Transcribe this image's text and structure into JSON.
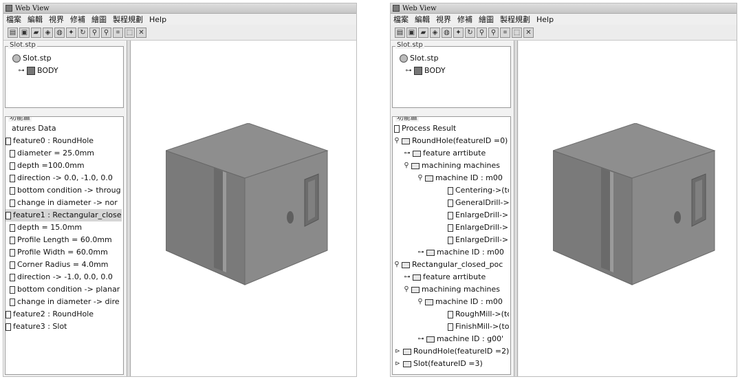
{
  "window_title": "Web View",
  "menu": [
    "檔案",
    "編輯",
    "視界",
    "修補",
    "繪圖",
    "製程規劃",
    "Help"
  ],
  "toolbar_icons": [
    "print-icon",
    "save-icon",
    "book-icon",
    "shape-icon",
    "globe-icon",
    "arrow-icon",
    "rotate-icon",
    "zoom-in-icon",
    "zoom-out-icon",
    "fit-icon",
    "select-icon",
    "close-icon"
  ],
  "file_panel": {
    "title": "Slot.stp",
    "root": "Slot.stp",
    "child": "BODY"
  },
  "func_panel_title": "功能區",
  "left_tree": [
    "atures Data",
    "feature0 : RoundHole",
    "diameter = 25.0mm",
    "depth =100.0mm",
    "direction -> 0.0, -1.0, 0.0",
    "bottom condition -> throug",
    "change in diameter -> nor",
    "feature1 : Rectangular_closec",
    "depth = 15.0mm",
    "Profile Length = 60.0mm",
    "Profile Width = 60.0mm",
    "Corner Radius = 4.0mm",
    "direction -> -1.0, 0.0, 0.0",
    "bottom condition -> planar",
    "change in diameter -> dire",
    "feature2 : RoundHole",
    "feature3 : Slot"
  ],
  "right_tree": [
    "Process Result",
    "RoundHole(featureID =0)",
    "feature arrtibute",
    "machining machines",
    "machine ID : m00",
    "Centering->(tc",
    "GeneralDrill->",
    "EnlargeDrill->",
    "EnlargeDrill->",
    "EnlargeDrill->",
    "machine ID : m00",
    "Rectangular_closed_poc",
    "feature arrtibute",
    "machining machines",
    "machine ID : m00",
    "RoughMill->(tc",
    "FinishMill->(to",
    "machine ID : g00'",
    "RoundHole(featureID =2)",
    "Slot(featureID =3)"
  ]
}
